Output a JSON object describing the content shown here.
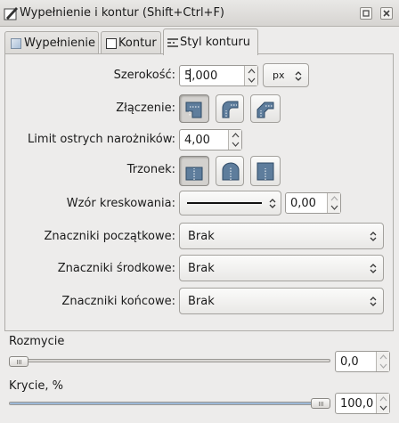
{
  "window": {
    "title": "Wypełnienie i kontur (Shift+Ctrl+F)"
  },
  "tabs": [
    {
      "label": "Wypełnienie",
      "active": false
    },
    {
      "label": "Kontur",
      "active": false
    },
    {
      "label": "Styl konturu",
      "active": true
    }
  ],
  "stroke_style": {
    "width_label": "Szerokość:",
    "width_value": "5,000",
    "unit": "px",
    "join_label": "Złączenie:",
    "join_options": [
      "miter-join",
      "round-join",
      "bevel-join"
    ],
    "join_selected": "miter-join",
    "miter_label": "Limit ostrych narożników:",
    "miter_value": "4,00",
    "cap_label": "Trzonek:",
    "cap_options": [
      "butt-cap",
      "round-cap",
      "square-cap"
    ],
    "cap_selected": "butt-cap",
    "dash_label": "Wzór kreskowania:",
    "dash_offset": "0,00",
    "start_markers_label": "Znaczniki początkowe:",
    "start_markers_value": "Brak",
    "mid_markers_label": "Znaczniki środkowe:",
    "mid_markers_value": "Brak",
    "end_markers_label": "Znaczniki końcowe:",
    "end_markers_value": "Brak"
  },
  "blur": {
    "label": "Rozmycie",
    "value": "0,0",
    "fraction": 0.0
  },
  "opacity": {
    "label": "Krycie, %",
    "value": "100,0",
    "fraction": 1.0
  },
  "colors": {
    "window_bg": "#edeceb",
    "selected_button": "#d3d1ce",
    "slider_fill": "#9db8d6"
  }
}
